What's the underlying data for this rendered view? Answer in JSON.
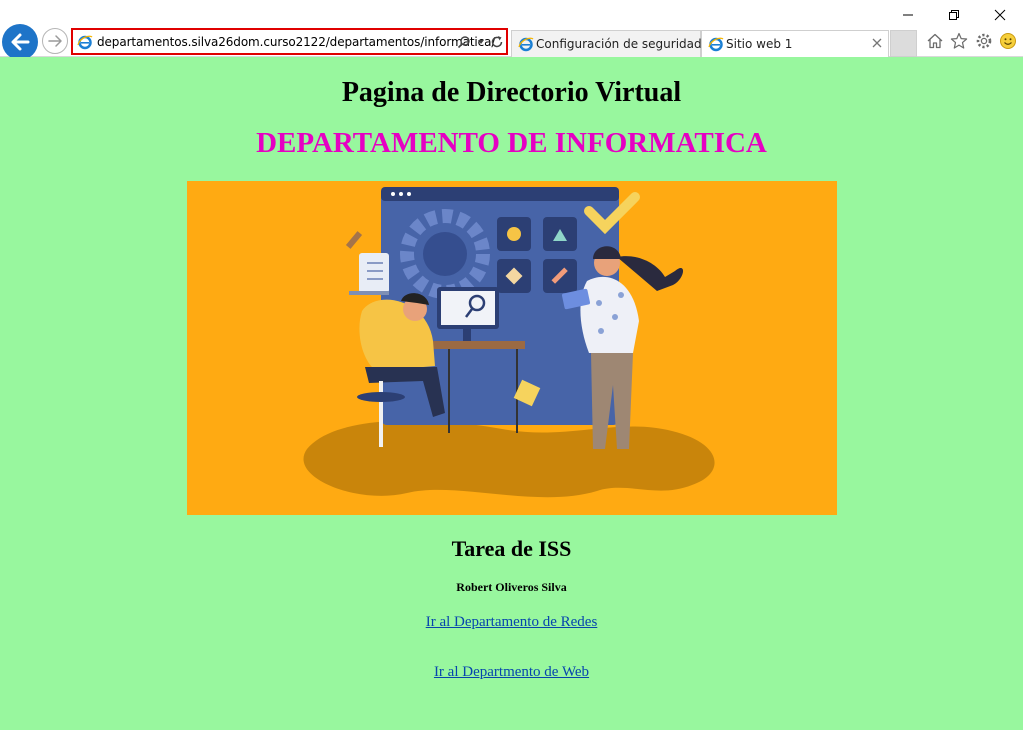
{
  "browser": {
    "address_url": "departamentos.silva26dom.curso2122/departamentos/informatica/",
    "tabs": [
      {
        "label": "Configuración de seguridad ..."
      },
      {
        "label": "Sitio web 1"
      }
    ]
  },
  "page": {
    "title": "Pagina de Directorio Virtual",
    "department": "DEPARTAMENTO DE INFORMATICA",
    "subtitle": "Tarea de ISS",
    "author": "Robert Oliveros Silva",
    "links": [
      {
        "label": "Ir al Departamento de Redes"
      },
      {
        "label": "Ir al Departmento de Web"
      }
    ]
  },
  "colors": {
    "page_background": "#98f79e",
    "department_text": "#e600c3",
    "link": "#0645ad",
    "hero_background": "#ffaa12",
    "address_highlight": "#e00000"
  },
  "icons": [
    "back-arrow-icon",
    "forward-arrow-icon",
    "ie-logo-icon",
    "search-icon",
    "dropdown-icon",
    "refresh-icon",
    "close-tab-icon",
    "home-icon",
    "favorites-star-icon",
    "settings-gear-icon",
    "feedback-smiley-icon",
    "minimize-icon",
    "maximize-icon",
    "close-window-icon"
  ]
}
